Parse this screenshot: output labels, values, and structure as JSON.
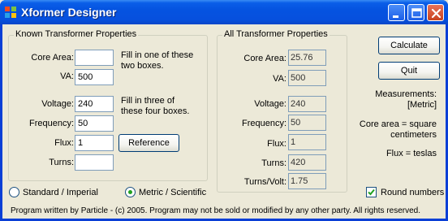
{
  "window": {
    "title": "Xformer Designer",
    "controls": {
      "minimize": "minimize-icon",
      "maximize": "maximize-icon",
      "close": "close-icon"
    }
  },
  "known": {
    "title": "Known Transformer Properties",
    "core_area": {
      "label": "Core Area:",
      "value": ""
    },
    "va": {
      "label": "VA:",
      "value": "500"
    },
    "hint1": [
      "Fill in one of these",
      "two boxes."
    ],
    "voltage": {
      "label": "Voltage:",
      "value": "240"
    },
    "frequency": {
      "label": "Frequency:",
      "value": "50"
    },
    "flux": {
      "label": "Flux:",
      "value": "1"
    },
    "turns": {
      "label": "Turns:",
      "value": ""
    },
    "hint2": [
      "Fill in three of",
      "these four boxes."
    ],
    "reference_button": "Reference"
  },
  "all": {
    "title": "All Transformer Properties",
    "core_area": {
      "label": "Core Area:",
      "value": "25.76"
    },
    "va": {
      "label": "VA:",
      "value": "500"
    },
    "voltage": {
      "label": "Voltage:",
      "value": "240"
    },
    "frequency": {
      "label": "Frequency:",
      "value": "50"
    },
    "flux": {
      "label": "Flux:",
      "value": "1"
    },
    "turns": {
      "label": "Turns:",
      "value": "420"
    },
    "turns_per_volt": {
      "label": "Turns/Volt:",
      "value": "1.75"
    }
  },
  "side": {
    "calculate_button": "Calculate",
    "quit_button": "Quit",
    "measurements": [
      "Measurements:",
      "[Metric]"
    ],
    "core_area_note": [
      "Core area = square",
      "centimeters"
    ],
    "flux_note": "Flux = teslas"
  },
  "units": {
    "standard": {
      "label": "Standard / Imperial",
      "selected": false
    },
    "metric": {
      "label": "Metric / Scientific",
      "selected": true
    }
  },
  "round_numbers": {
    "label": "Round numbers",
    "checked": true
  },
  "footer": "Program written by Particle  -  (c) 2005.   Program may not be sold or modified by any other party.  All rights reserved.",
  "colors": {
    "titlebar": "#0553e0",
    "face": "#ece9d8",
    "radio_dot": "#21a121",
    "check_mark": "#21a121"
  }
}
